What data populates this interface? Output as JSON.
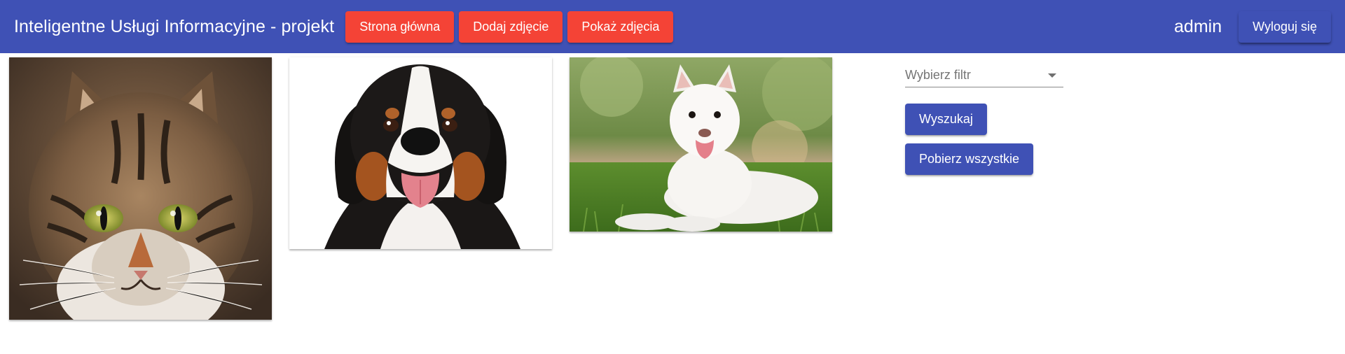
{
  "toolbar": {
    "title": "Inteligentne Usługi Informacyjne - projekt",
    "nav": {
      "home_label": "Strona główna",
      "add_photo_label": "Dodaj zdjęcie",
      "show_photos_label": "Pokaż zdjęcia"
    },
    "username": "admin",
    "logout_label": "Wyloguj się",
    "colors": {
      "primary": "#3f51b5",
      "accent": "#f44336"
    }
  },
  "gallery": {
    "photos": [
      {
        "subject": "tabby cat"
      },
      {
        "subject": "bernese mountain dog"
      },
      {
        "subject": "white fluffy dog on grass"
      }
    ]
  },
  "filter": {
    "select_placeholder": "Wybierz filtr",
    "search_label": "Wyszukaj",
    "fetch_all_label": "Pobierz wszystkie"
  }
}
